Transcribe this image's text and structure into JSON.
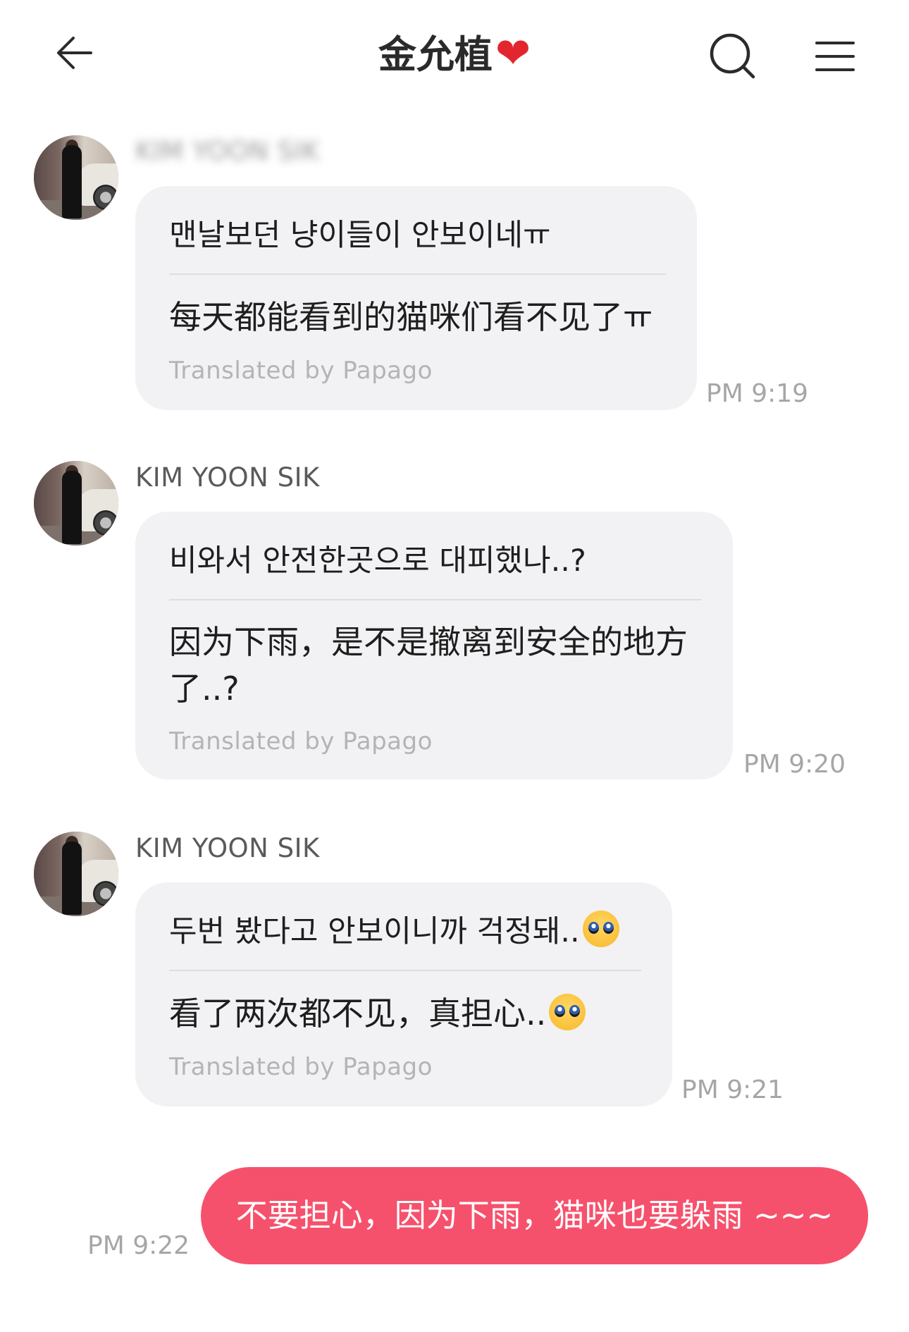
{
  "header": {
    "title": "金允植",
    "title_emoji": "❤",
    "back_icon": "back-arrow-icon",
    "search_icon": "search-icon",
    "menu_icon": "hamburger-menu-icon"
  },
  "messages": [
    {
      "sender": "KIM YOON SIK",
      "original": "맨날보던 냥이들이 안보이네ㅠ",
      "translation": "每天都能看到的猫咪们看不见了ㅠ",
      "translated_by": "Translated by Papago",
      "time": "PM 9:19"
    },
    {
      "sender": "KIM YOON SIK",
      "original": "비와서 안전한곳으로 대피했나..?",
      "translation_line1": "因为下雨，是不是撤离到安全的地方",
      "translation_line2": "了..?",
      "translated_by": "Translated by Papago",
      "time": "PM 9:20"
    },
    {
      "sender": "KIM YOON SIK",
      "original": "두번 봤다고 안보이니까 걱정돼..",
      "translation": "看了两次都不见，真担心..",
      "emoji": "pleading-face",
      "translated_by": "Translated by Papago",
      "time": "PM 9:21"
    }
  ],
  "outgoing": {
    "text": "不要担心，因为下雨，猫咪也要躲雨 ~~~",
    "time": "PM 9:22"
  },
  "colors": {
    "incoming_bubble": "#f2f2f4",
    "outgoing_bubble": "#f6516c",
    "heart": "#e3262e",
    "muted_text": "#a6a6a8"
  }
}
